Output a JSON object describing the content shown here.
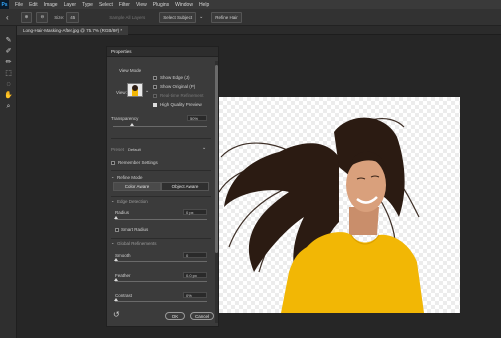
{
  "menu": {
    "logo": "Ps",
    "items": [
      "File",
      "Edit",
      "Image",
      "Layer",
      "Type",
      "Select",
      "Filter",
      "View",
      "Plugins",
      "Window",
      "Help"
    ]
  },
  "options_bar": {
    "size_label": "Size:",
    "size_value": "45",
    "refine_hair": "Refine Hair",
    "select_subject": "Select Subject",
    "sample_all_layers": "Sample All Layers"
  },
  "tab": {
    "title": "Long-Hair-Masking-After.jpg @ 75.7% (RGB/8#) *"
  },
  "properties": {
    "title": "Properties",
    "view_mode": {
      "heading": "View Mode",
      "view_label": "View:",
      "options": [
        {
          "label": "Show Edge (J)",
          "checked": false
        },
        {
          "label": "Show Original (P)",
          "checked": false
        },
        {
          "label": "Real-time Refinement",
          "checked": false
        },
        {
          "label": "High Quality Preview",
          "checked": true
        }
      ]
    },
    "transparency": {
      "label": "Transparency",
      "value": "50%"
    },
    "preset": {
      "label": "Preset",
      "value": "Default"
    },
    "remember_settings": "Remember Settings",
    "refine_mode": {
      "heading": "Refine Mode",
      "options": [
        "Color Aware",
        "Object Aware"
      ],
      "selected": "Color Aware"
    },
    "edge_detection": {
      "heading": "Edge Detection",
      "radius_label": "Radius",
      "radius_value": "0 px",
      "smart_radius": "Smart Radius"
    },
    "global_refinements": {
      "heading": "Global Refinements",
      "smooth_label": "Smooth",
      "smooth_value": "0",
      "feather_label": "Feather",
      "feather_value": "0.0 px",
      "contrast_label": "Contrast",
      "contrast_value": "0%"
    },
    "ok": "OK",
    "cancel": "Cancel"
  },
  "icons": [
    "home-icon",
    "lasso-icon",
    "brush-icon",
    "hand-icon",
    "zoom-icon",
    "reset-icon"
  ],
  "colors": {
    "shirt": "#f2b705",
    "hair": "#2b1b12",
    "skin": "#d9a07c"
  }
}
